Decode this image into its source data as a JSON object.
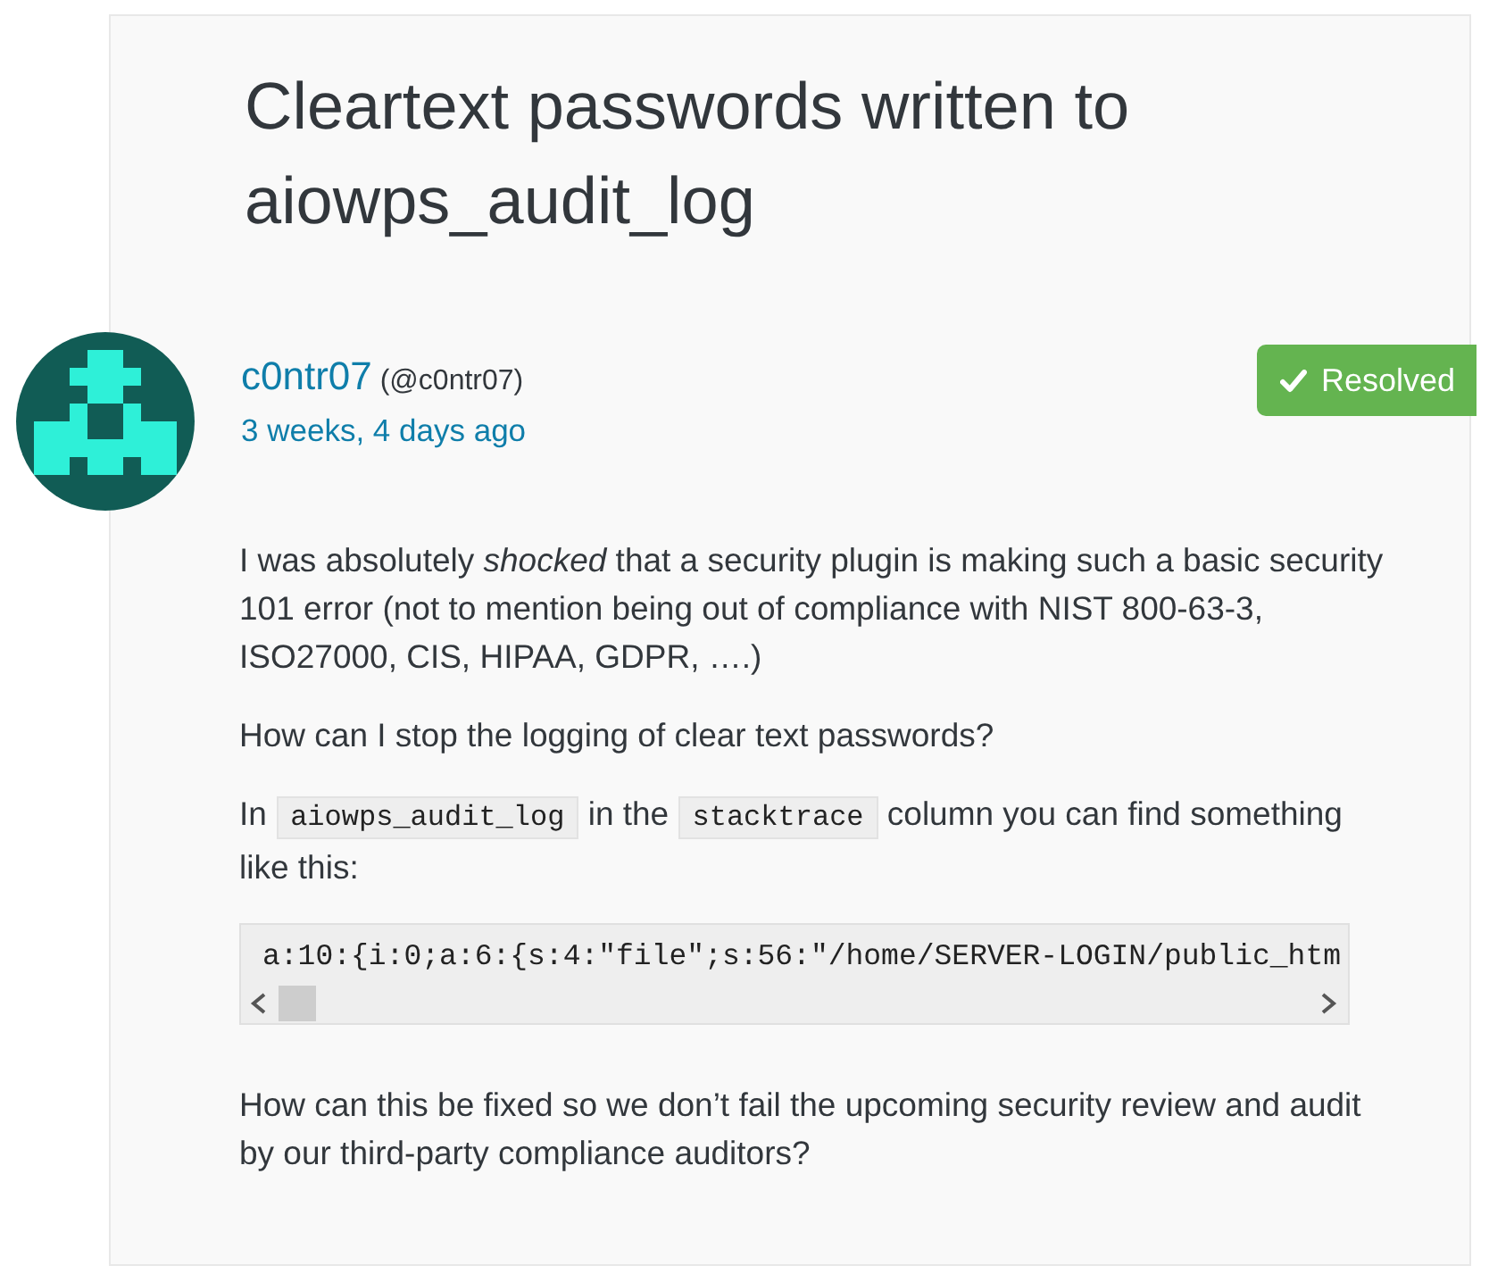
{
  "topic": {
    "title": "Cleartext passwords written to aiowps_audit_log",
    "status": {
      "label": "Resolved"
    }
  },
  "author": {
    "display_name": "c0ntr07",
    "username": "(@c0ntr07)",
    "posted": "3 weeks, 4 days ago"
  },
  "body": [
    {
      "kind": "paragraph",
      "text": "I was absolutely *shocked* that a security plugin is making such a basic security 101 error (not to mention being out of compliance with NIST 800-63-3, ISO27000, CIS, HIPAA, GDPR, ….)"
    },
    {
      "kind": "paragraph",
      "text": "How can I stop the logging of clear text passwords?"
    },
    {
      "kind": "mixed",
      "segments": [
        {
          "kind": "text",
          "text": "In"
        },
        {
          "kind": "code",
          "text": "aiowps_audit_log"
        },
        {
          "kind": "text",
          "text": "in the"
        },
        {
          "kind": "code",
          "text": "stacktrace"
        },
        {
          "kind": "text",
          "text": "column you can find something like this:"
        }
      ]
    },
    {
      "kind": "code_block",
      "text": "a:10:{i:0;a:6:{s:4:\"file\";s:56:\"/home/SERVER-LOGIN/public_htm"
    },
    {
      "kind": "paragraph",
      "text": "How can this be fixed so we don’t fail the upcoming security review and audit by our third-party compliance auditors?"
    }
  ]
}
